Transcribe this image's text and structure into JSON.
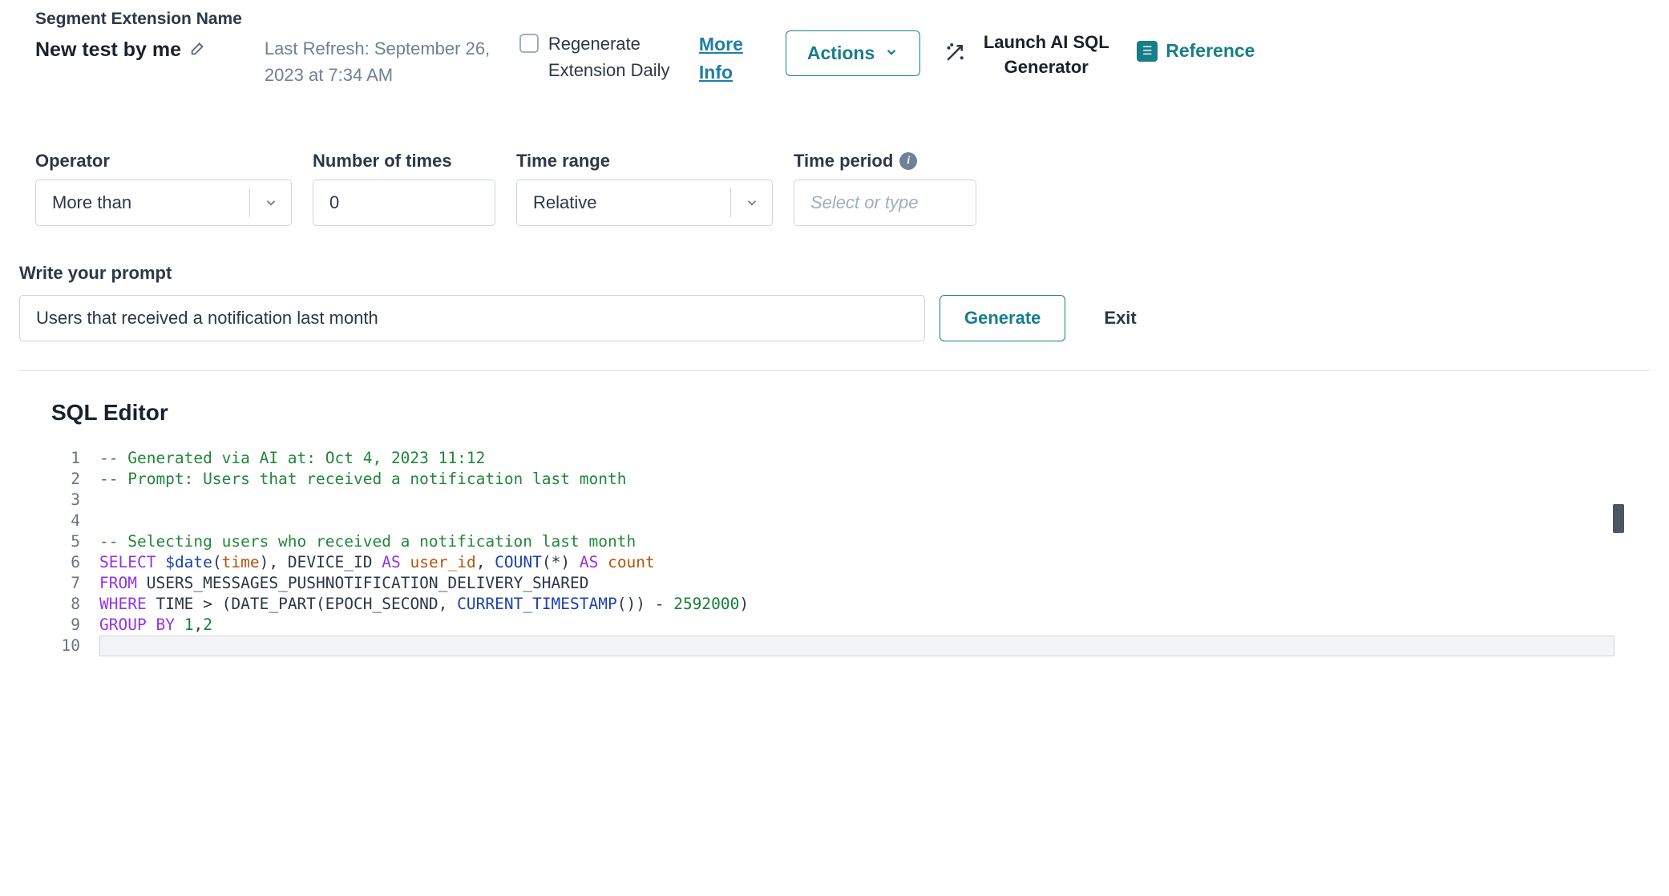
{
  "header": {
    "subLabel": "Segment Extension Name",
    "title": "New test by me",
    "lastRefresh": "Last Refresh: September 26, 2023 at 7:34 AM",
    "regenerateLabel": "Regenerate Extension Daily",
    "moreInfo": "More Info",
    "actionsLabel": "Actions",
    "aiLaunchLabel": "Launch AI SQL Generator",
    "referenceLabel": "Reference"
  },
  "filters": {
    "operator": {
      "label": "Operator",
      "value": "More than"
    },
    "numTimes": {
      "label": "Number of times",
      "value": "0"
    },
    "timeRange": {
      "label": "Time range",
      "value": "Relative"
    },
    "timePeriod": {
      "label": "Time period",
      "placeholder": "Select or type"
    }
  },
  "prompt": {
    "label": "Write your prompt",
    "value": "Users that received a notification last month",
    "generateLabel": "Generate",
    "exitLabel": "Exit"
  },
  "editor": {
    "title": "SQL Editor",
    "lineNumbers": [
      "1",
      "2",
      "3",
      "4",
      "5",
      "6",
      "7",
      "8",
      "9",
      "10"
    ],
    "comment1": "-- Generated via AI at: Oct 4, 2023 11:12",
    "comment2": "-- Prompt: Users that received a notification last month",
    "comment3": "-- Selecting users who received a notification last month",
    "kw_select": "SELECT",
    "fn_date": "$date",
    "id_time_l": "time",
    "kw_as1": "AS",
    "id_userid": "user_id",
    "fn_count": "COUNT",
    "kw_as2": "AS",
    "id_count": "count",
    "kw_from": "FROM",
    "tbl": "USERS_MESSAGES_PUSHNOTIFICATION_DELIVERY_SHARED",
    "kw_where": "WHERE",
    "col_time": "TIME",
    "fn_curts": "CURRENT_TIMESTAMP",
    "num_epoch": "2592000",
    "kw_group": "GROUP",
    "kw_by": "BY",
    "num_1": "1",
    "num_2": "2",
    "txt_deviceid": ", DEVICE_ID ",
    "txt_comma_sp": ", ",
    "txt_star": "(*) ",
    "txt_gt": " > (DATE_PART(EPOCH_SECOND, ",
    "txt_closepar": "()) - "
  }
}
